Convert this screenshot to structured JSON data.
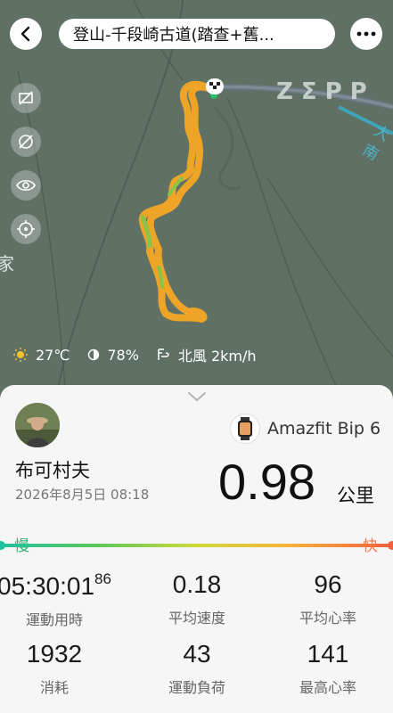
{
  "header": {
    "title": "登山-千段崎古道(踏查+舊..."
  },
  "map": {
    "brand": "ZΣPP",
    "river_label": "大南",
    "place_label": "家",
    "side_buttons": [
      "satellite-off-icon",
      "compass-off-icon",
      "eye-icon",
      "locate-icon"
    ]
  },
  "weather": {
    "temperature": "27℃",
    "humidity": "78%",
    "wind": "北風 2km/h"
  },
  "summary": {
    "device": "Amazfit Bip 6",
    "user": "布可村夫",
    "date": "2026年8月5日 08:18",
    "distance": "0.98",
    "distance_unit": "公里"
  },
  "speed_scale": {
    "slow": "慢",
    "fast": "快"
  },
  "stats": [
    {
      "value": "05:30:01",
      "sup": "86",
      "label": "運動用時"
    },
    {
      "value": "0.18",
      "label": "平均速度"
    },
    {
      "value": "96",
      "label": "平均心率"
    },
    {
      "value": "1932",
      "label": "消耗"
    },
    {
      "value": "43",
      "label": "運動負荷"
    },
    {
      "value": "141",
      "label": "最高心率"
    }
  ],
  "colors": {
    "route": "#f5a623",
    "route_slow": "#8bc34a",
    "panel": "#f6f6f7"
  }
}
